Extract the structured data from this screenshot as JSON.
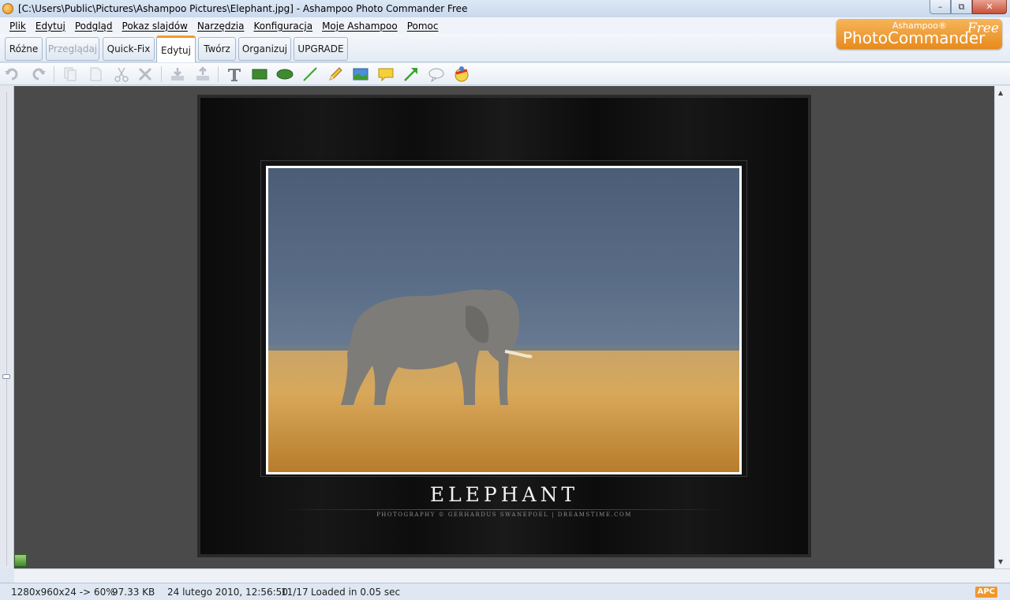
{
  "window": {
    "title": "[C:\\Users\\Public\\Pictures\\Ashampoo Pictures\\Elephant.jpg] - Ashampoo Photo Commander Free",
    "minimize_label": "–",
    "maximize_label": "⧉",
    "close_label": "✕"
  },
  "menu": {
    "items": [
      "Plik",
      "Edytuj",
      "Podgląd",
      "Pokaz slajdów",
      "Narzędzia",
      "Konfiguracja",
      "Moje Ashampoo",
      "Pomoc"
    ]
  },
  "logo": {
    "brand_small": "Ashampoo®",
    "product": "PhotoCommander",
    "edition": "Free"
  },
  "tabs": [
    {
      "label": "Różne",
      "state": "normal"
    },
    {
      "label": "Przeglądaj",
      "state": "disabled"
    },
    {
      "label": "Quick-Fix",
      "state": "normal"
    },
    {
      "label": "Edytuj",
      "state": "active"
    },
    {
      "label": "Twórz",
      "state": "normal"
    },
    {
      "label": "Organizuj",
      "state": "normal"
    },
    {
      "label": "UPGRADE",
      "state": "normal"
    }
  ],
  "toolbar": {
    "icons": [
      "undo-icon",
      "redo-icon",
      "copy-icon",
      "paste-icon",
      "cut-icon",
      "delete-icon",
      "import-icon",
      "export-icon",
      "text-tool-icon",
      "rectangle-tool-icon",
      "ellipse-tool-icon",
      "line-tool-icon",
      "pencil-tool-icon",
      "image-insert-icon",
      "note-tool-icon",
      "arrow-tool-icon",
      "speech-bubble-icon",
      "stamp-icon"
    ]
  },
  "poster": {
    "title": "ELEPHANT",
    "credit": "PHOTOGRAPHY © GERHARDUS SWANEPOEL | DREAMSTIME.COM"
  },
  "status": {
    "dimensions": "1280x960x24 -> 60%",
    "filesize": "97.33 KB",
    "date": "24 lutego 2010, 12:56:50",
    "position": "11/17",
    "loaded": "Loaded in 0.05 sec",
    "badge": "APC"
  },
  "colors": {
    "accent_orange": "#f29a2e",
    "chrome_blue": "#dde6f1",
    "canvas_gray": "#4a4a4a"
  }
}
